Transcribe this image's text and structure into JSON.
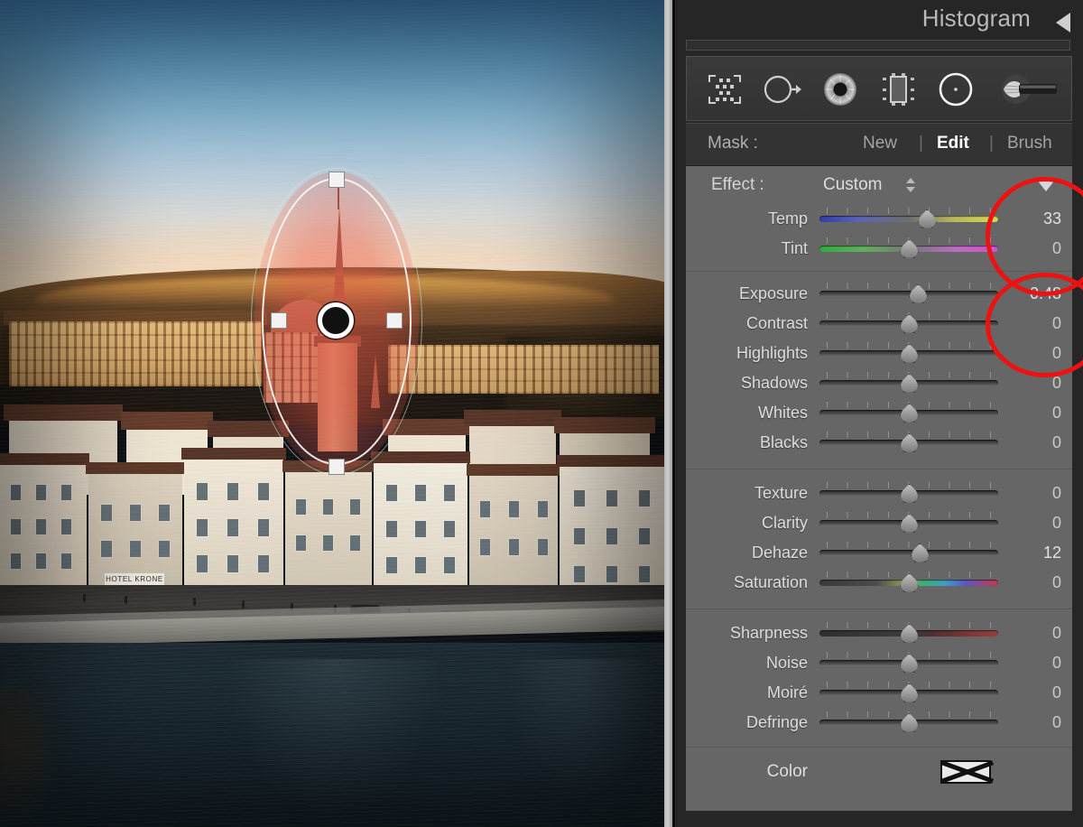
{
  "panel": {
    "histogram_title": "Histogram",
    "collapse_icon": "triangle-left-icon",
    "tools": [
      {
        "name": "select-subject-tool",
        "icon": "dotted-selection-icon",
        "label": "Select Subject"
      },
      {
        "name": "healing-tool",
        "icon": "circle-arrow-icon",
        "label": "Healing"
      },
      {
        "name": "red-eye-tool",
        "icon": "iris-eye-icon",
        "label": "Red Eye Correction"
      },
      {
        "name": "crop-tool",
        "icon": "crop-frame-icon",
        "label": "Crop Overlay"
      },
      {
        "name": "radial-gradient-tool",
        "icon": "radial-circle-icon",
        "label": "Radial Gradient"
      },
      {
        "name": "brush-tool",
        "icon": "brush-icon",
        "label": "Adjustment Brush"
      }
    ],
    "mask": {
      "label": "Mask :",
      "new": "New",
      "edit": "Edit",
      "brush": "Brush",
      "separator": "|",
      "active": "Edit"
    },
    "effect": {
      "label": "Effect :",
      "value": "Custom",
      "spinner_icon": "spinner-updown-icon",
      "reset_icon": "triangle-down-icon"
    },
    "groups": [
      {
        "name": "white-balance",
        "sliders": [
          {
            "label": "Temp",
            "value": "33",
            "pos": 60,
            "track": "temp"
          },
          {
            "label": "Tint",
            "value": "0",
            "pos": 50,
            "track": "tint"
          }
        ]
      },
      {
        "name": "tone",
        "sliders": [
          {
            "label": "Exposure",
            "value": "0.48",
            "pos": 55,
            "track": "plain"
          },
          {
            "label": "Contrast",
            "value": "0",
            "pos": 50,
            "track": "plain"
          },
          {
            "label": "Highlights",
            "value": "0",
            "pos": 50,
            "track": "plain"
          },
          {
            "label": "Shadows",
            "value": "0",
            "pos": 50,
            "track": "plain"
          },
          {
            "label": "Whites",
            "value": "0",
            "pos": 50,
            "track": "plain"
          },
          {
            "label": "Blacks",
            "value": "0",
            "pos": 50,
            "track": "plain"
          }
        ]
      },
      {
        "name": "presence",
        "sliders": [
          {
            "label": "Texture",
            "value": "0",
            "pos": 50,
            "track": "plain"
          },
          {
            "label": "Clarity",
            "value": "0",
            "pos": 50,
            "track": "plain"
          },
          {
            "label": "Dehaze",
            "value": "12",
            "pos": 56,
            "track": "plain"
          },
          {
            "label": "Saturation",
            "value": "0",
            "pos": 50,
            "track": "sat"
          }
        ]
      },
      {
        "name": "detail",
        "sliders": [
          {
            "label": "Sharpness",
            "value": "0",
            "pos": 50,
            "track": "sharp"
          },
          {
            "label": "Noise",
            "value": "0",
            "pos": 50,
            "track": "plain"
          },
          {
            "label": "Moiré",
            "value": "0",
            "pos": 50,
            "track": "plain"
          },
          {
            "label": "Defringe",
            "value": "0",
            "pos": 50,
            "track": "plain"
          }
        ]
      }
    ],
    "color": {
      "label": "Color",
      "swatch_icon": "no-color-x-swatch"
    }
  },
  "photo": {
    "description": "Zurich Limmatquai at sunset with river, church spire and old town",
    "overlay": {
      "type": "radial-gradient-mask",
      "pin_icon": "mask-pin-icon",
      "handles": [
        "top",
        "left",
        "right",
        "bottom"
      ],
      "mask_color": "#ec5848"
    },
    "sign_text": "HOTEL KRONE"
  },
  "annotations": {
    "accent_color": "#ee1111",
    "circles": [
      {
        "name": "temp-value-annotation",
        "target": "Temp / Tint values"
      },
      {
        "name": "exposure-value-annotation",
        "target": "Exposure / Contrast values"
      }
    ]
  }
}
